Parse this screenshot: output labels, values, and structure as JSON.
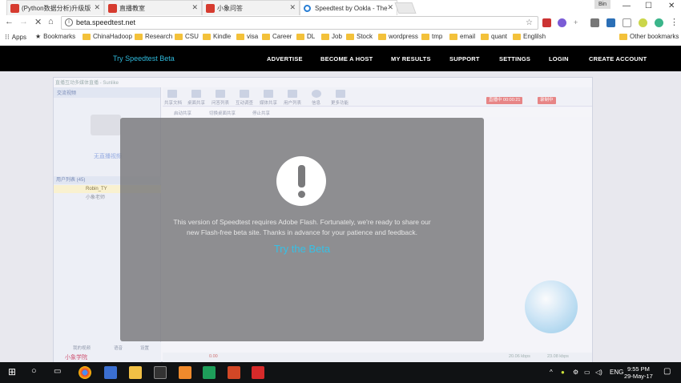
{
  "browser": {
    "tabs": [
      {
        "title": "(Python数据分析)升级版",
        "active": false
      },
      {
        "title": "直播教室",
        "active": false
      },
      {
        "title": "小象问答",
        "active": false
      },
      {
        "title": "Speedtest by Ookla - The",
        "active": true
      }
    ],
    "profile_label": "Bin",
    "url": "beta.speedtest.net",
    "bookmarks": [
      "Apps",
      "Bookmarks",
      "ChinaHadoop",
      "Research",
      "CSU",
      "Kindle",
      "visa",
      "Career",
      "DL",
      "Job",
      "Stock",
      "wordpress",
      "tmp",
      "email",
      "quant",
      "Englilsh",
      "Other bookmarks"
    ]
  },
  "site_nav": {
    "brand": "Try Speedtest Beta",
    "links": [
      "ADVERTISE",
      "BECOME A HOST",
      "MY RESULTS",
      "SUPPORT",
      "SETTINGS",
      "LOGIN",
      "CREATE ACCOUNT"
    ]
  },
  "background_app": {
    "title": "直播互动多媒体直播 - Sunlike",
    "left_header": "交流视频",
    "no_video": "无直播视频",
    "user_list_header": "用户列表 (45)",
    "users": [
      "Robin_TY",
      "小象老师"
    ],
    "toolbar": [
      "共享文档",
      "桌面共享",
      "问答列表",
      "互动调查",
      "媒体共享",
      "用户列表",
      "信息",
      "更多功能"
    ],
    "subbar": [
      "启动共享",
      "切换桌面共享",
      "停止共享"
    ],
    "red_buttons": [
      "直播中 00:00:21",
      "录制中"
    ],
    "left_bottom": [
      "我的视频",
      "语音",
      "设置"
    ],
    "logo_text": "小象学院",
    "status_left": "0.00",
    "status_right": [
      "20.06 kbps",
      "23.08 kbps"
    ]
  },
  "modal": {
    "message": "This version of Speedtest requires Adobe Flash. Fortunately, we're ready to share our new Flash-free beta site. Thanks in advance for your patience and feedback.",
    "cta": "Try the Beta"
  },
  "taskbar": {
    "tray": {
      "language": "ENG"
    },
    "clock": {
      "time": "9:55 PM",
      "date": "29-May-17"
    }
  },
  "colors": {
    "brand_blue": "#36c0e6",
    "nav_bg": "#000000",
    "modal_bg": "#7a7a7c"
  }
}
